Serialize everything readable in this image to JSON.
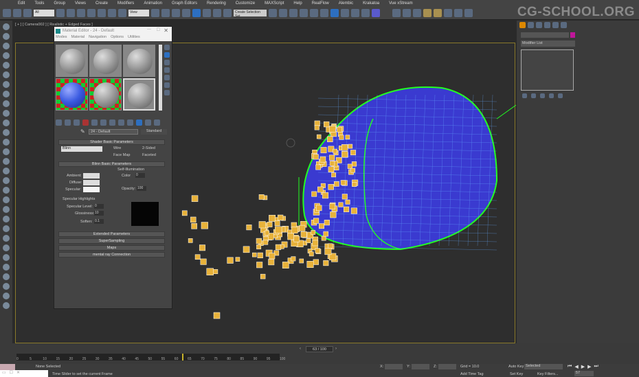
{
  "menu": [
    "Edit",
    "Tools",
    "Group",
    "Views",
    "Create",
    "Modifiers",
    "Animation",
    "Graph Editors",
    "Rendering",
    "Customize",
    "MAXScript",
    "Help",
    "RealFlow",
    "Alembic",
    "Krakatoa",
    "Vue xStream"
  ],
  "toolbar": {
    "filter": "All",
    "ref_coord": "View",
    "selection_set": "Create Selection Set"
  },
  "watermark": "CG-SCHOOL.ORG",
  "viewport": {
    "label": "[ + ] [ Camera002 ] [ Realistic + Edged Faces ]"
  },
  "material_editor": {
    "title": "Material Editor - 24 - Default",
    "menu": [
      "Modes",
      "Material",
      "Navigation",
      "Options",
      "Utilities"
    ],
    "material_name": "24 - Default",
    "material_type": "Standard",
    "shader_rollout": "Shader Basic Parameters",
    "shader": "Blinn",
    "checks": [
      "Wire",
      "2-Sided",
      "Face Map",
      "Faceted"
    ],
    "blinn_rollout": "Blinn Basic Parameters",
    "self_illum": "Self-Illumination",
    "color_label": "Color",
    "color_value": "0",
    "ambient": "Ambient:",
    "diffuse": "Diffuse:",
    "specular": "Specular:",
    "opacity_label": "Opacity:",
    "opacity_value": "100",
    "spec_highlights": "Specular Highlights",
    "spec_level_label": "Specular Level:",
    "spec_level": "0",
    "glossiness_label": "Glossiness:",
    "glossiness": "10",
    "soften_label": "Soften:",
    "soften": "0.1",
    "rollouts": [
      "Extended Parameters",
      "SuperSampling",
      "Maps",
      "mental ray Connection"
    ]
  },
  "command_panel": {
    "modifier_list": "Modifier List",
    "accent": "#c0169a"
  },
  "timeline": {
    "frame": "63 / 100",
    "ticks": [
      "0",
      "5",
      "10",
      "15",
      "20",
      "25",
      "30",
      "35",
      "40",
      "45",
      "50",
      "55",
      "60",
      "65",
      "70",
      "75",
      "80",
      "85",
      "90",
      "95",
      "100"
    ],
    "progress": 0.63
  },
  "status": {
    "selection": "None Selected",
    "prompt": "Time Slider to set the current Frame",
    "x_label": "X:",
    "y_label": "Y:",
    "z_label": "Z:",
    "grid": "Grid = 10.0",
    "add_time_tag": "Add Time Tag",
    "auto_key": "Auto Key",
    "auto_key_mode": "Selected",
    "set_key": "Set Key",
    "key_filters": "Key Filters...",
    "current_frame": "57"
  }
}
